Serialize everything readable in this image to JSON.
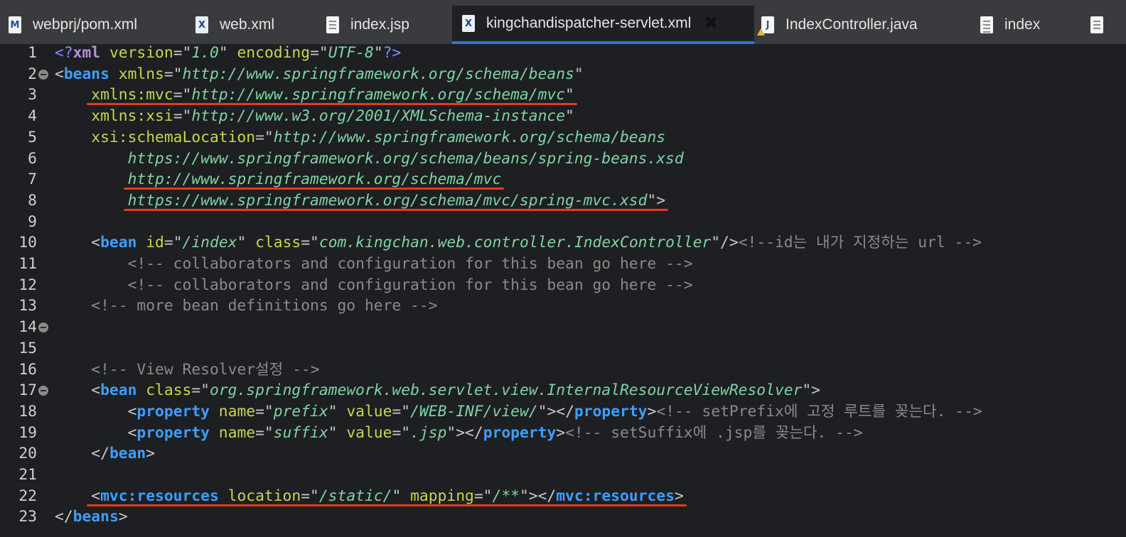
{
  "tabs": [
    {
      "label": "webprj/pom.xml",
      "icon": "maven-file-icon",
      "active": false
    },
    {
      "label": "web.xml",
      "icon": "xml-file-icon",
      "active": false
    },
    {
      "label": "index.jsp",
      "icon": "jsp-file-icon",
      "active": false
    },
    {
      "label": "kingchandispatcher-servlet.xml",
      "icon": "xml-file-icon",
      "active": true
    },
    {
      "label": "IndexController.java",
      "icon": "java-file-icon-warning",
      "active": false
    },
    {
      "label": "index",
      "icon": "page-file-icon",
      "active": false
    }
  ],
  "editor": {
    "lines": [
      {
        "n": "1",
        "t": [
          [
            "pi",
            "<?"
          ],
          [
            "kw",
            "xml"
          ],
          [
            "attr",
            " version"
          ],
          [
            "punc",
            "=\""
          ],
          [
            "val",
            "1.0"
          ],
          [
            "punc",
            "\""
          ],
          [
            "attr",
            " encoding"
          ],
          [
            "punc",
            "=\""
          ],
          [
            "val",
            "UTF-8"
          ],
          [
            "punc",
            "\""
          ],
          [
            "pi",
            "?>"
          ]
        ]
      },
      {
        "n": "2",
        "t": [
          [
            "punc",
            "<"
          ],
          [
            "tag",
            "beans"
          ],
          [
            "attr",
            " xmlns"
          ],
          [
            "punc",
            "=\""
          ],
          [
            "val",
            "http://www.springframework.org/schema/beans"
          ],
          [
            "punc",
            "\""
          ]
        ]
      },
      {
        "n": "3",
        "t": [
          [
            "attr",
            "    xmlns:mvc"
          ],
          [
            "punc",
            "=\""
          ],
          [
            "val",
            "http://www.springframework.org/schema/mvc"
          ],
          [
            "punc",
            "\""
          ]
        ]
      },
      {
        "n": "4",
        "t": [
          [
            "attr",
            "    xmlns:xsi"
          ],
          [
            "punc",
            "=\""
          ],
          [
            "val",
            "http://www.w3.org/2001/XMLSchema-instance"
          ],
          [
            "punc",
            "\""
          ]
        ]
      },
      {
        "n": "5",
        "t": [
          [
            "attr",
            "    xsi:schemaLocation"
          ],
          [
            "punc",
            "=\""
          ],
          [
            "val",
            "http://www.springframework.org/schema/beans"
          ]
        ]
      },
      {
        "n": "6",
        "t": [
          [
            "val",
            "        https://www.springframework.org/schema/beans/spring-beans.xsd"
          ]
        ]
      },
      {
        "n": "7",
        "t": [
          [
            "val",
            "        http://www.springframework.org/schema/mvc"
          ]
        ]
      },
      {
        "n": "8",
        "t": [
          [
            "val",
            "        https://www.springframework.org/schema/mvc/spring-mvc.xsd"
          ],
          [
            "punc",
            "\">"
          ]
        ]
      },
      {
        "n": "9",
        "t": []
      },
      {
        "n": "10",
        "t": [
          [
            "punc",
            "    <"
          ],
          [
            "tag",
            "bean"
          ],
          [
            "attr",
            " id"
          ],
          [
            "punc",
            "=\""
          ],
          [
            "val",
            "/index"
          ],
          [
            "punc",
            "\""
          ],
          [
            "attr",
            " class"
          ],
          [
            "punc",
            "=\""
          ],
          [
            "val",
            "com.kingchan.web.controller.IndexController"
          ],
          [
            "punc",
            "\"/>"
          ],
          [
            "com",
            "<!--id는 내가 지정하는 url -->"
          ]
        ]
      },
      {
        "n": "11",
        "t": [
          [
            "com",
            "        <!-- collaborators and configuration for this bean go here -->"
          ]
        ]
      },
      {
        "n": "12",
        "t": [
          [
            "com",
            "        <!-- collaborators and configuration for this bean go here -->"
          ]
        ]
      },
      {
        "n": "13",
        "t": [
          [
            "com",
            "    <!-- more bean definitions go here -->"
          ]
        ]
      },
      {
        "n": "14",
        "t": []
      },
      {
        "n": "15",
        "t": []
      },
      {
        "n": "16",
        "t": [
          [
            "com",
            "    <!-- View Resolver설정 -->"
          ]
        ]
      },
      {
        "n": "17",
        "t": [
          [
            "punc",
            "    <"
          ],
          [
            "tag",
            "bean"
          ],
          [
            "attr",
            " class"
          ],
          [
            "punc",
            "=\""
          ],
          [
            "val",
            "org.springframework.web.servlet.view.InternalResourceViewResolver"
          ],
          [
            "punc",
            "\">"
          ]
        ]
      },
      {
        "n": "18",
        "t": [
          [
            "punc",
            "        <"
          ],
          [
            "tag",
            "property"
          ],
          [
            "attr",
            " name"
          ],
          [
            "punc",
            "=\""
          ],
          [
            "val",
            "prefix"
          ],
          [
            "punc",
            "\""
          ],
          [
            "attr",
            " value"
          ],
          [
            "punc",
            "=\""
          ],
          [
            "val",
            "/WEB-INF/view/"
          ],
          [
            "punc",
            "\"></"
          ],
          [
            "tag",
            "property"
          ],
          [
            "punc",
            ">"
          ],
          [
            "com",
            "<!-- setPrefix에 고정 루트를 꽂는다. -->"
          ]
        ]
      },
      {
        "n": "19",
        "t": [
          [
            "punc",
            "        <"
          ],
          [
            "tag",
            "property"
          ],
          [
            "attr",
            " name"
          ],
          [
            "punc",
            "=\""
          ],
          [
            "val",
            "suffix"
          ],
          [
            "punc",
            "\""
          ],
          [
            "attr",
            " value"
          ],
          [
            "punc",
            "=\""
          ],
          [
            "val",
            ".jsp"
          ],
          [
            "punc",
            "\"></"
          ],
          [
            "tag",
            "property"
          ],
          [
            "punc",
            ">"
          ],
          [
            "com",
            "<!-- setSuffix에 .jsp를 꽂는다. -->"
          ]
        ]
      },
      {
        "n": "20",
        "t": [
          [
            "punc",
            "    </"
          ],
          [
            "tag",
            "bean"
          ],
          [
            "punc",
            ">"
          ]
        ]
      },
      {
        "n": "21",
        "t": []
      },
      {
        "n": "22",
        "t": [
          [
            "punc",
            "    <"
          ],
          [
            "tag",
            "mvc:resources"
          ],
          [
            "attr",
            " location"
          ],
          [
            "punc",
            "=\""
          ],
          [
            "val",
            "/static/"
          ],
          [
            "punc",
            "\""
          ],
          [
            "attr",
            " mapping"
          ],
          [
            "punc",
            "=\""
          ],
          [
            "val",
            "/**"
          ],
          [
            "punc",
            "\"></"
          ],
          [
            "tag",
            "mvc:resources"
          ],
          [
            "punc",
            ">"
          ]
        ]
      },
      {
        "n": "23",
        "t": [
          [
            "punc",
            "</"
          ],
          [
            "tag",
            "beans"
          ],
          [
            "punc",
            ">"
          ]
        ]
      }
    ],
    "fold_lines": [
      "2",
      "14",
      "17"
    ],
    "underlined_lines": [
      "3",
      "7",
      "8",
      "22"
    ]
  },
  "colors": {
    "underline": "#e63b16",
    "active_tab_indicator": "#2f76d1",
    "tag": "#3d9eff",
    "attribute": "#c8d64d",
    "value": "#7fd3a6",
    "comment": "#8a8a8a"
  }
}
